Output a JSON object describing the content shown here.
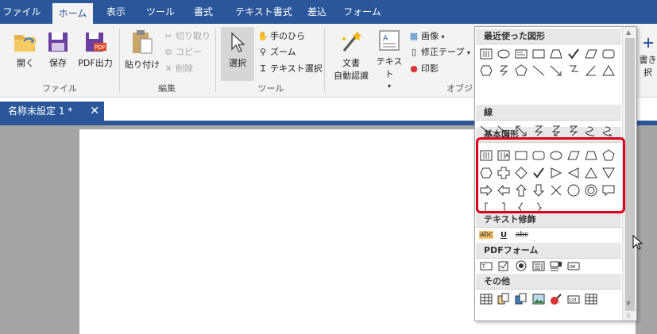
{
  "menu": {
    "tabs": [
      "ファイル",
      "ホーム",
      "表示",
      "ツール",
      "書式",
      "テキスト書式",
      "差込",
      "フォーム"
    ]
  },
  "ribbon": {
    "file_group": {
      "label": "ファイル",
      "open": "開く",
      "save": "保存",
      "pdf_out": "PDF出力"
    },
    "edit_group": {
      "label": "編集",
      "paste": "貼り付け",
      "cut": "切り取り",
      "copy": "コピー",
      "delete": "削除"
    },
    "tool_group": {
      "label": "ツール",
      "select": "選択",
      "hand": "手のひら",
      "zoom": "ズーム",
      "text_select": "テキスト選択"
    },
    "object_group": {
      "label": "オブジ",
      "ocr_line1": "文書",
      "ocr_line2": "自動認識",
      "text": "テキスト",
      "image": "画像",
      "correction_tape": "修正テープ",
      "stamp": "印影"
    },
    "right_partial": {
      "line1": "書き",
      "line2": "択"
    }
  },
  "document": {
    "tab_title": "名称未設定 1 *",
    "close": "✕"
  },
  "shapes_panel": {
    "sections": {
      "recent": "最近使った図形",
      "lines": "線",
      "basic": "基本図形",
      "text_edit": "テキスト修飾",
      "pdf_form": "PDFフォーム",
      "other": "その他"
    },
    "text_edit_items": [
      "abc",
      "U",
      "abc"
    ]
  },
  "colors": {
    "accent": "#2b579a",
    "highlight": "#e0001b",
    "icon_blue": "#1f5fa8"
  }
}
